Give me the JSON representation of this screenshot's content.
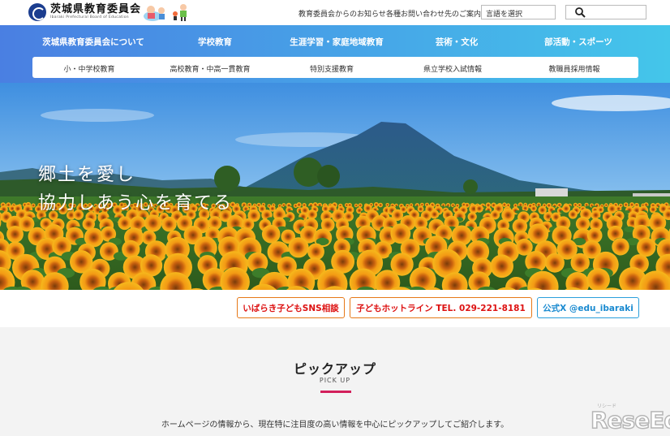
{
  "header": {
    "org_name": "茨城県教育委員会",
    "org_name_en": "Ibaraki Prefectural Board of Education",
    "links": [
      "教育委員会からのお知らせ",
      "各種お問い合わせ先のご案内"
    ],
    "language_select": "言語を選択",
    "search_value": ""
  },
  "nav_main": [
    "茨城県教育委員会について",
    "学校教育",
    "生涯学習・家庭地域教育",
    "芸術・文化",
    "部活動・スポーツ"
  ],
  "nav_sub": [
    "小・中学校教育",
    "高校教育・中高一貫教育",
    "特別支援教育",
    "県立学校入試情報",
    "教職員採用情報"
  ],
  "hero": {
    "tagline_line1": "郷土を愛し",
    "tagline_line2": "協力しあう心を育てる"
  },
  "buttons": [
    {
      "label": "いばらき子どもSNS相談",
      "color": "#e67817"
    },
    {
      "label": "子どもホットライン TEL. 029-221-8181",
      "color": "#e67817"
    },
    {
      "label": "公式X @edu_ibaraki",
      "color": "#2a9fdb"
    }
  ],
  "pickup": {
    "title": "ピックアップ",
    "subtitle": "PICK UP",
    "description": "ホームページの情報から、現在特に注目度の高い情報を中心にピックアップしてご紹介します。",
    "accent_color": "#d21f5b"
  },
  "watermark": {
    "brand": "ReseEd",
    "reading": "リシード"
  },
  "colors": {
    "nav_start": "#4a7fe2",
    "nav_end": "#44c6ea"
  }
}
